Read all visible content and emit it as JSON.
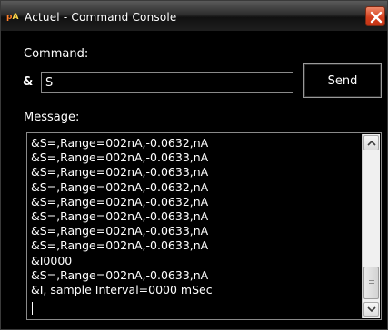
{
  "window": {
    "icon_text_p": "p",
    "icon_text_a": "A",
    "title": "Actuel - Command Console"
  },
  "command": {
    "label": "Command:",
    "prefix": "&",
    "value": "S",
    "send_label": "Send"
  },
  "message": {
    "label": "Message:",
    "lines": [
      "&S=,Range=002nA,-0.0632,nA",
      "&S=,Range=002nA,-0.0633,nA",
      "&S=,Range=002nA,-0.0633,nA",
      "&S=,Range=002nA,-0.0632,nA",
      "&S=,Range=002nA,-0.0632,nA",
      "&S=,Range=002nA,-0.0633,nA",
      "&S=,Range=002nA,-0.0633,nA",
      "&S=,Range=002nA,-0.0633,nA",
      "&I0000",
      "&S=,Range=002nA,-0.0633,nA",
      "&I, sample Interval=0000 mSec"
    ]
  },
  "colors": {
    "background": "#000000",
    "text": "#ffffff",
    "close_button": "#d4401e"
  }
}
